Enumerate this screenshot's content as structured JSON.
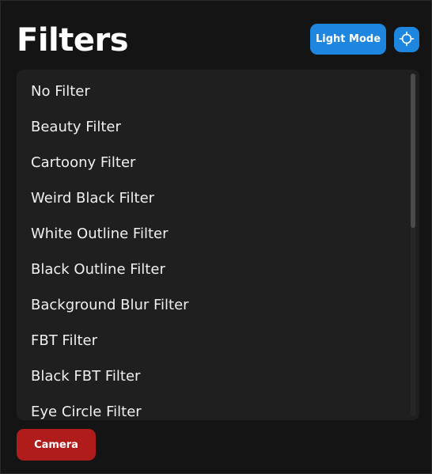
{
  "header": {
    "title": "Filters",
    "light_mode_label": "Light Mode",
    "target_icon": "crosshair-icon"
  },
  "filters": {
    "items": [
      "No Filter",
      "Beauty Filter",
      "Cartoony Filter",
      "Weird Black Filter",
      "White Outline Filter",
      "Black Outline Filter",
      "Background Blur Filter",
      "FBT Filter",
      "Black FBT Filter",
      "Eye Circle Filter"
    ]
  },
  "footer": {
    "camera_label": "Camera"
  },
  "colors": {
    "background": "#141414",
    "panel": "#1f1f1f",
    "accent_blue": "#1f86e0",
    "accent_red": "#b01c1c",
    "text": "#f0f0f0"
  }
}
